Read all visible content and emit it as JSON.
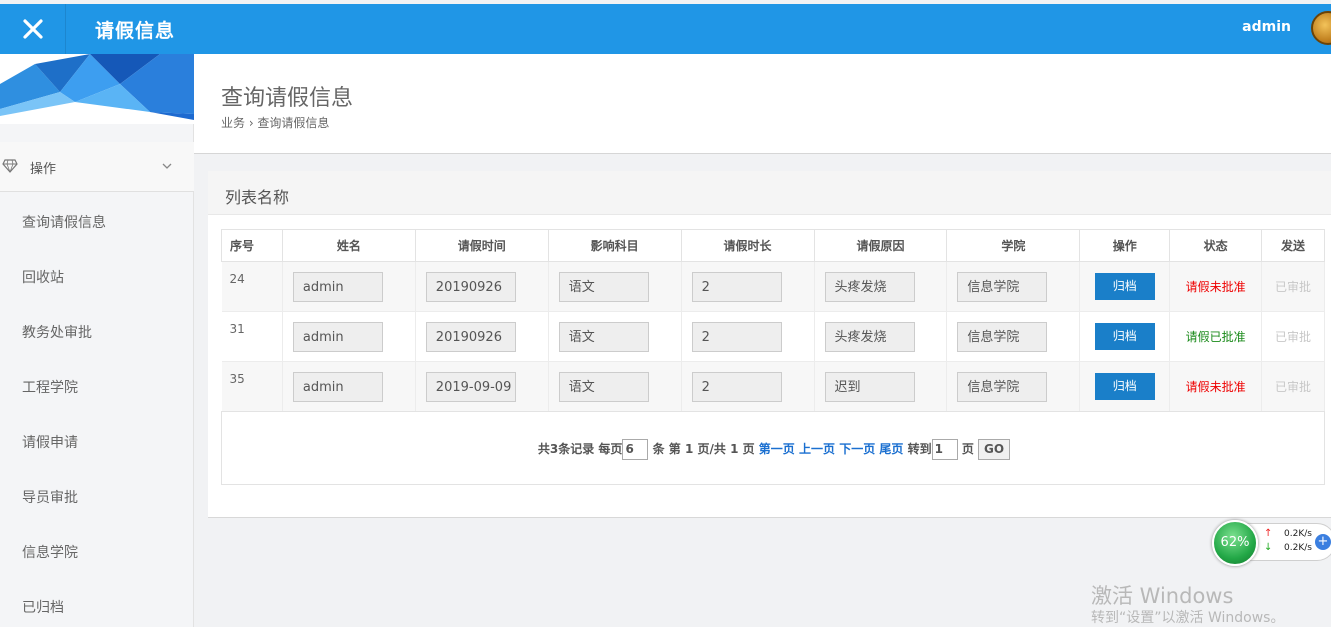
{
  "header": {
    "app_title": "请假信息",
    "user_name": "admin"
  },
  "sidebar": {
    "group_label": "操作",
    "items": [
      {
        "label": "查询请假信息"
      },
      {
        "label": "回收站"
      },
      {
        "label": "教务处审批"
      },
      {
        "label": "工程学院"
      },
      {
        "label": "请假申请"
      },
      {
        "label": "导员审批"
      },
      {
        "label": "信息学院"
      },
      {
        "label": "已归档"
      }
    ]
  },
  "page": {
    "title": "查询请假信息",
    "breadcrumb": "业务 › 查询请假信息"
  },
  "card": {
    "title": "列表名称"
  },
  "table": {
    "headers": [
      "序号",
      "姓名",
      "请假时间",
      "影响科目",
      "请假时长",
      "请假原因",
      "学院",
      "操作",
      "状态",
      "发送"
    ],
    "rows": [
      {
        "id": "24",
        "name": "admin",
        "time": "20190926",
        "subject": "语文",
        "duration": "2",
        "reason": "头疼发烧",
        "college": "信息学院",
        "action": "归档",
        "status": "请假未批准",
        "status_color": "#e00000",
        "send": "已审批"
      },
      {
        "id": "31",
        "name": "admin",
        "time": "20190926",
        "subject": "语文",
        "duration": "2",
        "reason": "头疼发烧",
        "college": "信息学院",
        "action": "归档",
        "status": "请假已批准",
        "status_color": "#1a8a1a",
        "send": "已审批"
      },
      {
        "id": "35",
        "name": "admin",
        "time": "2019-09-09",
        "subject": "语文",
        "duration": "2",
        "reason": "迟到",
        "college": "信息学院",
        "action": "归档",
        "status": "请假未批准",
        "status_color": "#e00000",
        "send": "已审批"
      }
    ]
  },
  "pager": {
    "total_text": "共3条记录 每页",
    "per_page": "6",
    "page_info": "条 第 1 页/共 1 页",
    "first": "第一页",
    "prev": "上一页",
    "next": "下一页",
    "last": "尾页",
    "goto_label": "转到",
    "goto_value": "1",
    "page_suffix": "页",
    "go_label": "GO"
  },
  "net_widget": {
    "percent": "62%",
    "up_speed": "0.2K/s",
    "down_speed": "0.2K/s"
  },
  "watermark": {
    "line1": "激活 Windows",
    "line2": "转到“设置”以激活 Windows。"
  },
  "colors": {
    "topbar": "#2096e6",
    "archive_button": "#1a7fc9",
    "status_red": "#e00000",
    "status_green": "#1a8a1a"
  }
}
